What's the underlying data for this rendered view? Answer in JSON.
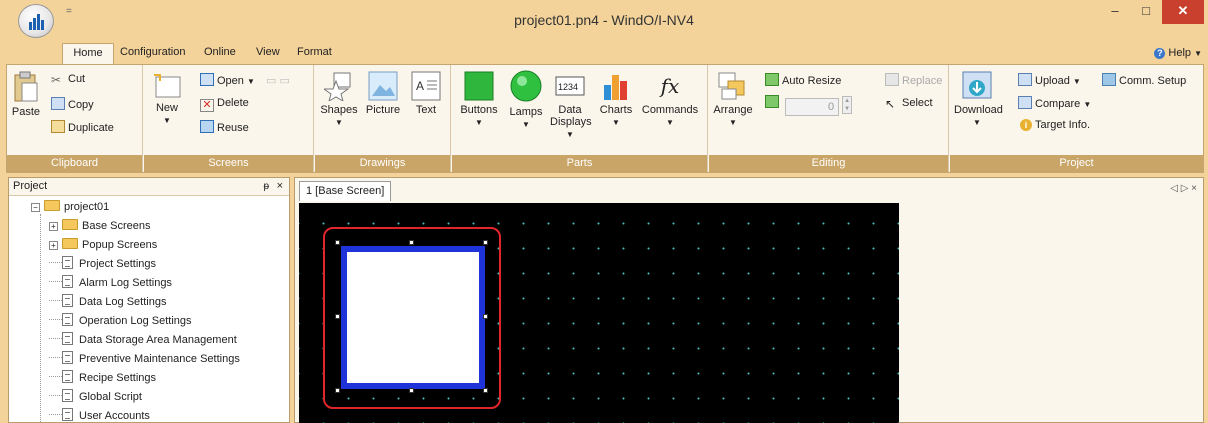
{
  "window": {
    "title": "project01.pn4 - WindO/I-NV4",
    "qat_arrow": "=",
    "minimize": "–",
    "maximize": "□",
    "close": "✕"
  },
  "tabs": [
    "Home",
    "Configuration",
    "Online",
    "View",
    "Format"
  ],
  "help": "Help",
  "ribbon": {
    "clipboard": {
      "label": "Clipboard",
      "paste": "Paste",
      "cut": "Cut",
      "copy": "Copy",
      "duplicate": "Duplicate"
    },
    "screens": {
      "label": "Screens",
      "new": "New",
      "open": "Open",
      "delete": "Delete",
      "reuse": "Reuse"
    },
    "drawings": {
      "label": "Drawings",
      "shapes": "Shapes",
      "picture": "Picture",
      "text": "Text"
    },
    "parts": {
      "label": "Parts",
      "buttons": "Buttons",
      "lamps": "Lamps",
      "data_displays_1": "Data",
      "data_displays_2": "Displays",
      "data_icon": "1234",
      "charts": "Charts",
      "commands": "Commands",
      "fx": "fx"
    },
    "editing": {
      "label": "Editing",
      "arrange": "Arrange",
      "auto_resize": "Auto Resize",
      "spin_value": "0",
      "replace": "Replace",
      "select": "Select"
    },
    "project": {
      "label": "Project",
      "download": "Download",
      "upload": "Upload",
      "compare": "Compare",
      "target_info": "Target Info.",
      "comm_setup": "Comm. Setup"
    }
  },
  "project_panel": {
    "title": "Project",
    "pin": "ᵽ",
    "close": "×",
    "root": "project01",
    "items": [
      "Base Screens",
      "Popup Screens",
      "Project Settings",
      "Alarm Log Settings",
      "Data Log Settings",
      "Operation Log Settings",
      "Data Storage Area Management",
      "Preventive Maintenance Settings",
      "Recipe Settings",
      "Global Script",
      "User Accounts"
    ]
  },
  "editor": {
    "tab": "1  [Base Screen]",
    "nav": "◁ ▷ ×"
  },
  "colors": {
    "accent": "#c9a567",
    "canvas": "#000000",
    "selection": "#e0262a",
    "object_border": "#1e33d9"
  }
}
